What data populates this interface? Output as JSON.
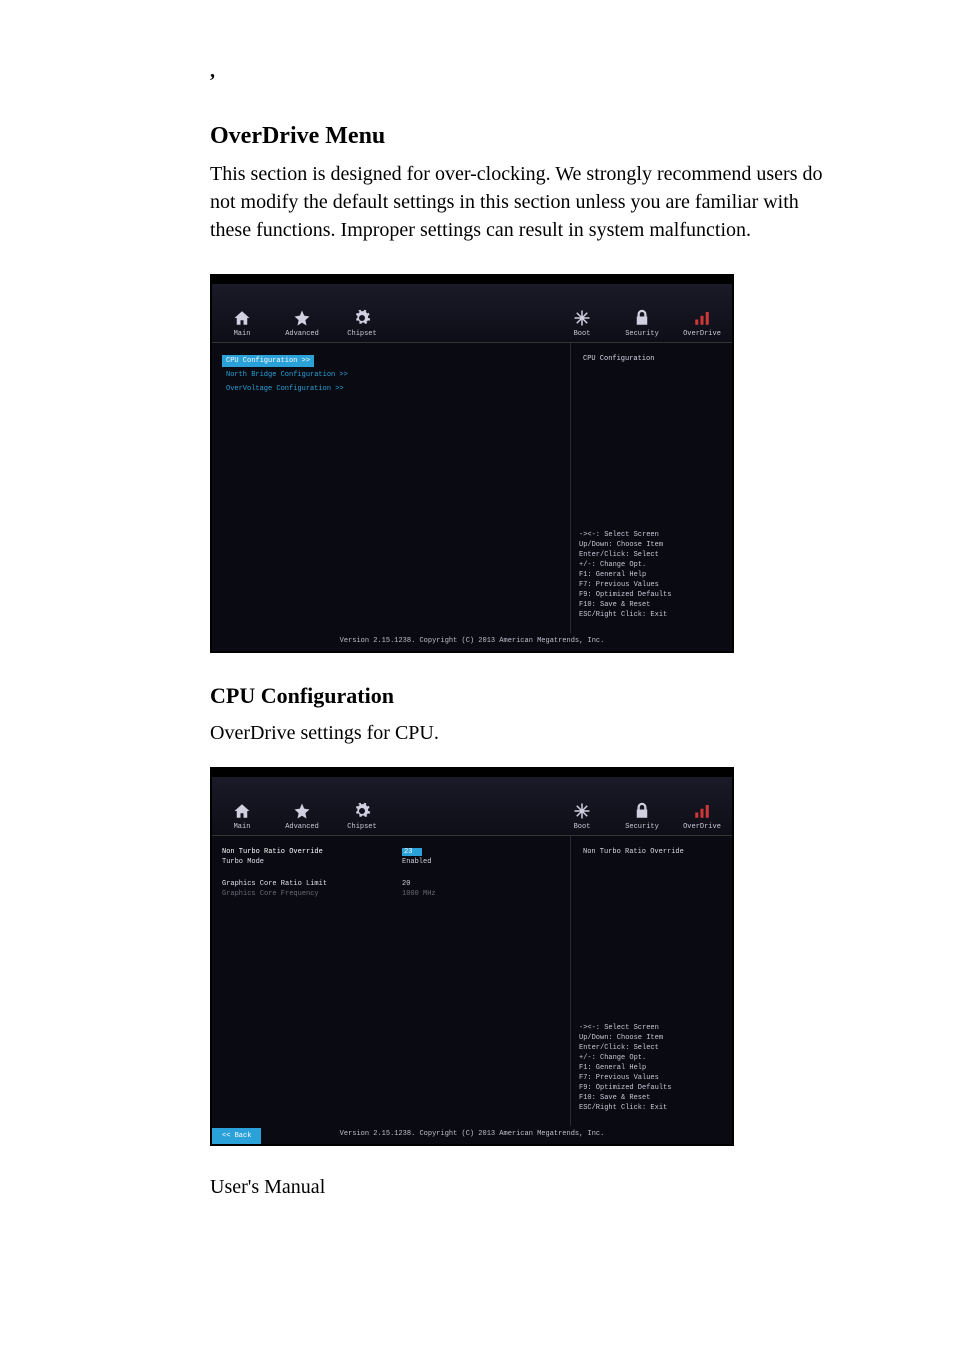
{
  "doc": {
    "comma": ",",
    "section_title": "OverDrive Menu",
    "section_body": "This section is designed for over-clocking. We strongly recommend users do not modify the default settings in this section unless you are familiar with these functions. Improper settings can result in system malfunction.",
    "sub_title": "CPU Configuration",
    "sub_body": "OverDrive settings for CPU.",
    "footer": "User's Manual"
  },
  "bios": {
    "tabs": {
      "main": "Main",
      "advanced": "Advanced",
      "chipset": "Chipset",
      "boot": "Boot",
      "security": "Security",
      "overdrive": "OverDrive"
    },
    "screen1": {
      "items": [
        {
          "label": "CPU Configuration >>",
          "key": "cpu"
        },
        {
          "label": "North Bridge Configuration >>",
          "key": "nb"
        },
        {
          "label": "OverVoltage Configuration >>",
          "key": "ov"
        }
      ],
      "right_heading": "CPU Configuration"
    },
    "screen2": {
      "rows": [
        {
          "label": "Non Turbo Ratio Override",
          "value": "23",
          "sel": true
        },
        {
          "label": "Turbo Mode",
          "value": "Enabled"
        },
        {
          "label_spacer": true
        },
        {
          "label": "Graphics Core Ratio Limit",
          "value": "20"
        },
        {
          "label": "Graphics Core Frequency",
          "value": "1000 MHz",
          "dim": true
        }
      ],
      "right_heading": "Non Turbo Ratio Override",
      "back": "<< Back"
    },
    "help": {
      "l1": "-><-: Select Screen",
      "l2": "Up/Down: Choose Item",
      "l3": "Enter/Click: Select",
      "l4": "+/-: Change Opt.",
      "l5": "F1:   General Help",
      "l6": "F7:   Previous Values",
      "l7": "F9:   Optimized Defaults",
      "l8": "F10:  Save & Reset",
      "l9": "ESC/Right Click: Exit"
    },
    "copyright": "Version 2.15.1238. Copyright (C) 2013 American Megatrends, Inc."
  }
}
